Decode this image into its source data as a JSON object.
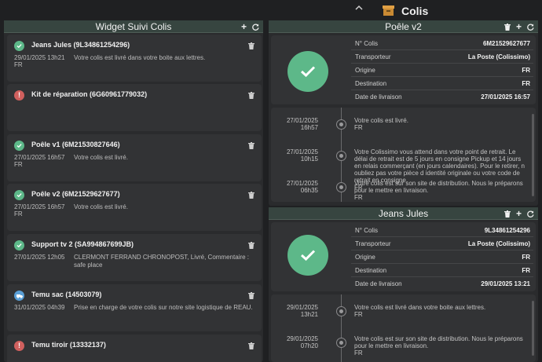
{
  "app": {
    "title": "Colis",
    "collapse_icon": "chevron-up-icon",
    "package_icon": "package-icon",
    "package_color": "#e0a044"
  },
  "colors": {
    "ok": "#5db889",
    "error": "#d0605e",
    "info": "#5a9fd6"
  },
  "widget": {
    "title": "Widget Suivi Colis",
    "items": [
      {
        "status": "ok",
        "name": "Jeans Jules (9L34861254296)",
        "date": "29/01/2025 13h21",
        "message": "Votre colis est livré dans votre boite aux lettres.",
        "country": "FR"
      },
      {
        "status": "err",
        "name": "Kit de réparation (6G60961779032)",
        "date": "",
        "message": "",
        "country": ""
      },
      {
        "status": "ok",
        "name": "Poêle v1 (6M21530827646)",
        "date": "27/01/2025 16h57",
        "message": "Votre colis est livré.",
        "country": "FR"
      },
      {
        "status": "ok",
        "name": "Poêle v2 (6M21529627677)",
        "date": "27/01/2025 16h57",
        "message": "Votre colis est livré.",
        "country": "FR"
      },
      {
        "status": "ok",
        "name": "Support tv 2 (SA994867699JB)",
        "date": "27/01/2025 12h05",
        "message": "CLERMONT FERRAND CHRONOPOST, Livré, Commentaire : safe place",
        "country": ""
      },
      {
        "status": "info",
        "name": "Temu sac (14503079)",
        "date": "31/01/2025 04h39",
        "message": "Prise en charge de votre colis sur notre site logistique de REAU.",
        "country": ""
      },
      {
        "status": "err",
        "name": "Temu tiroir (13332137)",
        "date": "",
        "message": "",
        "country": ""
      }
    ]
  },
  "detail_panels": [
    {
      "title": "Poêle v2",
      "fields": [
        {
          "label": "N° Colis",
          "value": "6M21529627677"
        },
        {
          "label": "Transporteur",
          "value": "La Poste (Colissimo)"
        },
        {
          "label": "Origine",
          "value": "FR"
        },
        {
          "label": "Destination",
          "value": "FR"
        },
        {
          "label": "Date de livraison",
          "value": "27/01/2025 16:57"
        }
      ],
      "events": [
        {
          "date": "27/01/2025",
          "time": "16h57",
          "message": "Votre colis est livré.",
          "country": "FR"
        },
        {
          "date": "27/01/2025",
          "time": "10h15",
          "message": "Votre Colissimo vous attend dans votre point de retrait. Le délai de retrait est de 5 jours en consigne Pickup et 14 jours en relais commerçant (en jours calendaires). Pour le retirer, n oubliez pas votre pièce d identité originale ou votre code de retrait en consigne.",
          "country": "FR"
        },
        {
          "date": "27/01/2025",
          "time": "06h35",
          "message": "Votre colis est sur son site de distribution. Nous le préparons pour le mettre en livraison.",
          "country": "FR"
        }
      ]
    },
    {
      "title": "Jeans Jules",
      "fields": [
        {
          "label": "N° Colis",
          "value": "9L34861254296"
        },
        {
          "label": "Transporteur",
          "value": "La Poste (Colissimo)"
        },
        {
          "label": "Origine",
          "value": "FR"
        },
        {
          "label": "Destination",
          "value": "FR"
        },
        {
          "label": "Date de livraison",
          "value": "29/01/2025 13:21"
        }
      ],
      "events": [
        {
          "date": "29/01/2025",
          "time": "13h21",
          "message": "Votre colis est livré dans votre boite aux lettres.",
          "country": "FR"
        },
        {
          "date": "29/01/2025",
          "time": "07h20",
          "message": "Votre colis est sur son site de distribution. Nous le préparons pour le mettre en livraison.",
          "country": "FR"
        }
      ]
    }
  ],
  "header_icons": [
    "trash-icon",
    "plus-icon",
    "refresh-icon"
  ]
}
